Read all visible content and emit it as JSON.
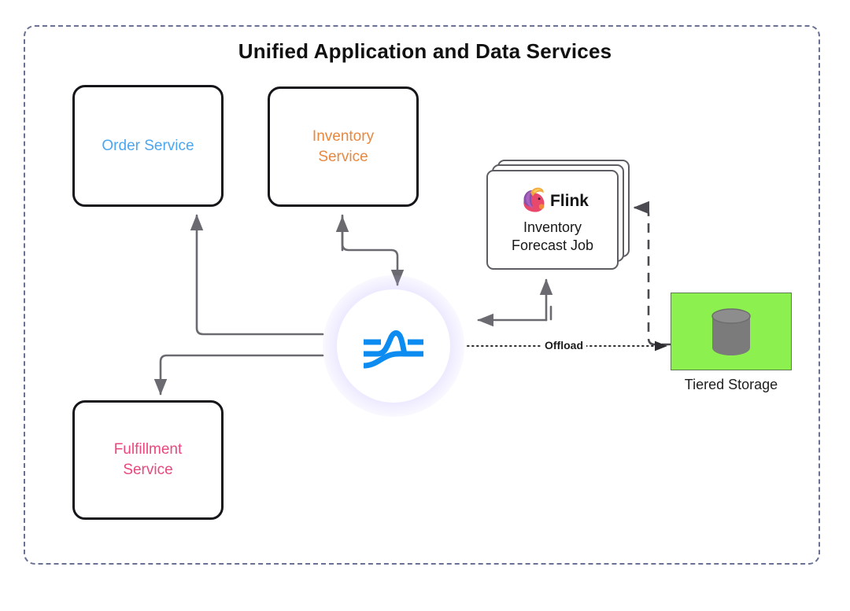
{
  "diagram": {
    "title": "Unified Application and Data Services",
    "boundary_style": "dashed",
    "boundary_color": "#6b7194",
    "background": "#ffffff"
  },
  "services": [
    {
      "id": "order",
      "label": "Order Service",
      "color": "#4da6f0",
      "border_color": "#16161a"
    },
    {
      "id": "inventory",
      "label": "Inventory\nService",
      "color": "#e8883f",
      "border_color": "#16161a"
    },
    {
      "id": "fulfillment",
      "label": "Fulfillment\nService",
      "color": "#e8477f",
      "border_color": "#16161a"
    }
  ],
  "hub": {
    "name": "pulsar-hub",
    "icon": "apache-pulsar-logo",
    "icon_color": "#0c8bf0",
    "glow_color": "#a896ff"
  },
  "flink_job": {
    "brand": "Flink",
    "icon": "apache-flink-squirrel-logo",
    "title": "Inventory\nForecast Job",
    "border_color": "#5d5d63"
  },
  "storage": {
    "label": "Tiered Storage",
    "fill_color": "#8cf14f",
    "icon": "database-cylinder-icon",
    "icon_color": "#7a7a7a"
  },
  "edges": {
    "offload_label": "Offload",
    "arrow_color": "#6a6a70",
    "dashed_arrow_color": "#4a4a50"
  }
}
